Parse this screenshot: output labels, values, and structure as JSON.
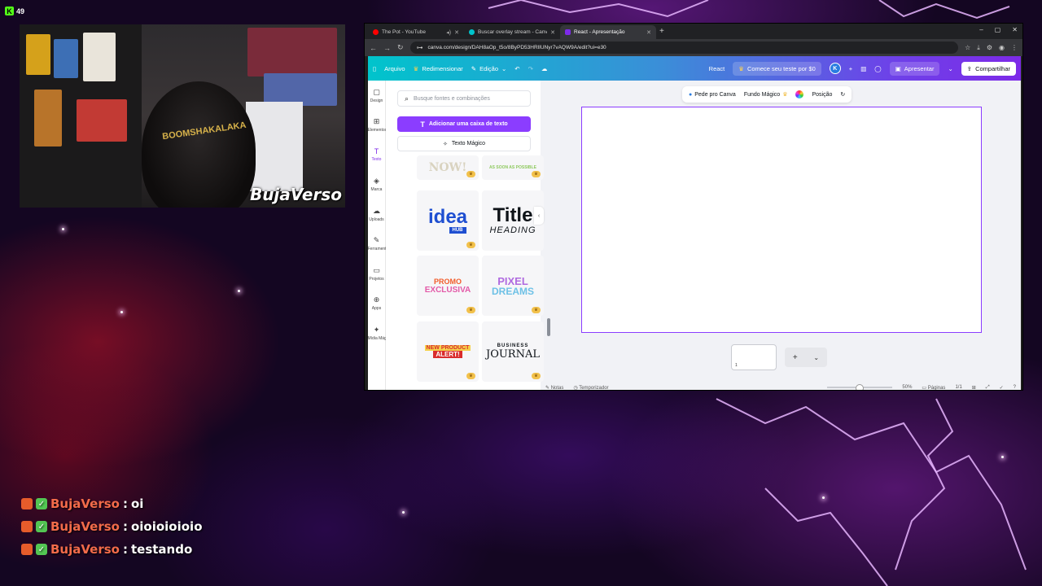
{
  "stream": {
    "viewer_count": "49",
    "cam_brand": "BujaVerso",
    "cap_text": "BOOMSHAKALAKA"
  },
  "browser": {
    "tabs": [
      {
        "label": "The Pot - YouTube",
        "icon_color": "#ff0000",
        "active": false
      },
      {
        "label": "Buscar overlay stream - Canva",
        "icon_color": "#00c4cc",
        "active": false
      },
      {
        "label": "React - Apresentação",
        "icon_color": "#7d2ae8",
        "active": true
      }
    ],
    "url": "canva.com/design/DAH8aOp_t5o/8ByPD53HRlIUNyr7vAQW9A/edit?ui=e30"
  },
  "canva": {
    "topbar": {
      "arquivo": "Arquivo",
      "redimensionar": "Redimensionar",
      "edicao": "Edição",
      "project_name": "React",
      "trial": "Comece seu teste por $0",
      "avatar_letter": "K",
      "apresentar": "Apresentar",
      "compartilhar": "Compartilhar"
    },
    "rail": [
      {
        "icon": "design-icon",
        "glyph": "▢",
        "label": "Design"
      },
      {
        "icon": "elements-icon",
        "glyph": "⊞",
        "label": "Elementos"
      },
      {
        "icon": "text-icon",
        "glyph": "T",
        "label": "Texto",
        "active": true
      },
      {
        "icon": "brand-icon",
        "glyph": "◈",
        "label": "Marca"
      },
      {
        "icon": "uploads-icon",
        "glyph": "☁",
        "label": "Uploads"
      },
      {
        "icon": "tools-icon",
        "glyph": "✎",
        "label": "Ferramentas"
      },
      {
        "icon": "projects-icon",
        "glyph": "▭",
        "label": "Projetos"
      },
      {
        "icon": "apps-icon",
        "glyph": "⊕",
        "label": "Apps"
      },
      {
        "icon": "magic-media-icon",
        "glyph": "✦",
        "label": "Mídia Mágica"
      }
    ],
    "panel": {
      "search_placeholder": "Busque fontes e combinações",
      "add_text": "Adicionar uma caixa de texto",
      "magic_text": "Texto Mágico",
      "tiles": [
        {
          "line1": "NOW!",
          "line2": ""
        },
        {
          "line1": "AS SOON AS POSSIBLE",
          "line2": ""
        },
        {
          "line1": "idea",
          "line2": "HUB"
        },
        {
          "line1": "Title",
          "line2": "HEADING"
        },
        {
          "line1": "PROMO",
          "line2": "EXCLUSIVA"
        },
        {
          "line1": "PIXEL",
          "line2": "DREAMS"
        },
        {
          "line1": "NEW PRODUCT",
          "line2": "ALERT!"
        },
        {
          "line1": "BUSINESS",
          "line2": "JOURNAL"
        }
      ]
    },
    "context_toolbar": {
      "ask_canva": "Pede pro Canva",
      "magic_bg": "Fundo Mágico",
      "position": "Posição"
    },
    "page_number": "1",
    "bottombar": {
      "notes": "Notas",
      "timer": "Temporizador",
      "zoom": "50%",
      "pages": "Páginas",
      "page_count": "1/1"
    }
  },
  "chat": [
    {
      "user": "BujaVerso",
      "message": "oi"
    },
    {
      "user": "BujaVerso",
      "message": "oioioioioio"
    },
    {
      "user": "BujaVerso",
      "message": "testando"
    }
  ]
}
